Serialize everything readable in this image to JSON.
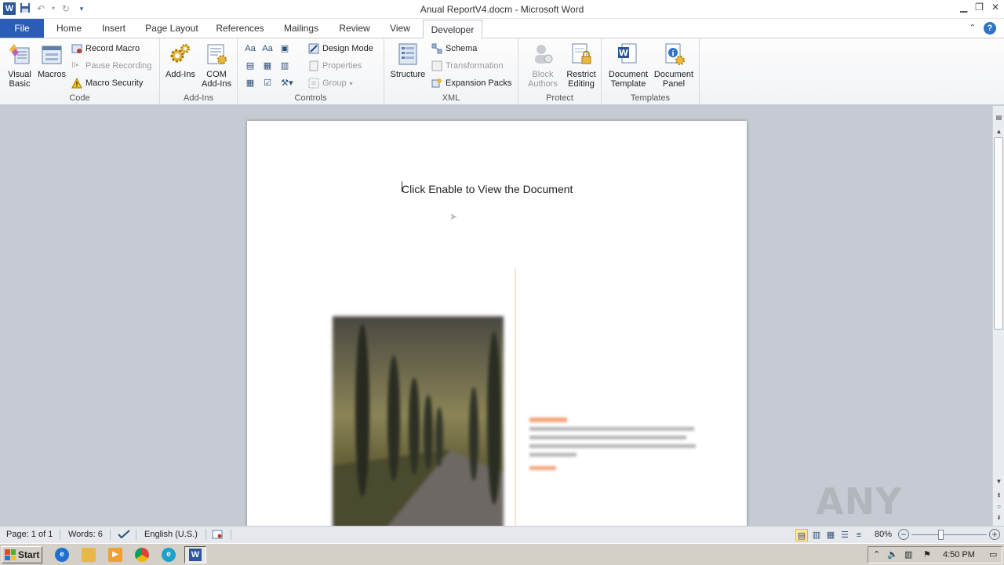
{
  "window": {
    "title": "Anual ReportV4.docm - Microsoft Word",
    "app_icon_letter": "W"
  },
  "tabs": {
    "file": "File",
    "items": [
      "Home",
      "Insert",
      "Page Layout",
      "References",
      "Mailings",
      "Review",
      "View",
      "Developer"
    ],
    "active": "Developer"
  },
  "ribbon": {
    "code": {
      "label": "Code",
      "visual_basic": "Visual Basic",
      "macros": "Macros",
      "record_macro": "Record Macro",
      "pause_recording": "Pause Recording",
      "macro_security": "Macro Security"
    },
    "addins": {
      "label": "Add-Ins",
      "add_ins": "Add-Ins",
      "com_add_ins": "COM Add-Ins"
    },
    "controls": {
      "label": "Controls",
      "design_mode": "Design Mode",
      "properties": "Properties",
      "group": "Group"
    },
    "xml": {
      "label": "XML",
      "structure": "Structure",
      "schema": "Schema",
      "transformation": "Transformation",
      "expansion_packs": "Expansion Packs"
    },
    "protect": {
      "label": "Protect",
      "block_authors": "Block Authors",
      "restrict_editing": "Restrict Editing"
    },
    "templates": {
      "label": "Templates",
      "document_template": "Document Template",
      "document_panel": "Document Panel"
    }
  },
  "document": {
    "message": "Click Enable to View the Document"
  },
  "statusbar": {
    "page": "Page: 1 of 1",
    "words": "Words: 6",
    "language": "English (U.S.)",
    "zoom": "80%",
    "zoom_level": 0.8
  },
  "taskbar": {
    "start": "Start",
    "clock": "4:50 PM"
  },
  "watermark": "ANY RUN"
}
